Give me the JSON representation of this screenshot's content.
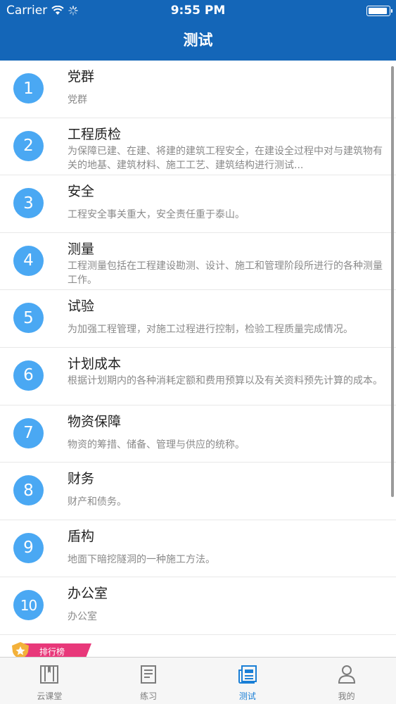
{
  "status_bar": {
    "carrier": "Carrier",
    "time": "9:55 PM",
    "battery_level": 0.95
  },
  "nav": {
    "title": "测试"
  },
  "items": [
    {
      "number": "1",
      "title": "党群",
      "description": "党群"
    },
    {
      "number": "2",
      "title": "工程质检",
      "description": "为保障已建、在建、将建的建筑工程安全，在建设全过程中对与建筑物有关的地基、建筑材料、施工工艺、建筑结构进行测试..."
    },
    {
      "number": "3",
      "title": "安全",
      "description": "工程安全事关重大，安全责任重于泰山。"
    },
    {
      "number": "4",
      "title": "测量",
      "description": "工程测量包括在工程建设勘测、设计、施工和管理阶段所进行的各种测量工作。"
    },
    {
      "number": "5",
      "title": "试验",
      "description": "为加强工程管理，对施工过程进行控制，检验工程质量完成情况。"
    },
    {
      "number": "6",
      "title": "计划成本",
      "description": "根据计划期内的各种消耗定额和费用预算以及有关资料预先计算的成本。"
    },
    {
      "number": "7",
      "title": "物资保障",
      "description": "物资的筹措、储备、管理与供应的统称。"
    },
    {
      "number": "8",
      "title": "财务",
      "description": "财产和债务。"
    },
    {
      "number": "9",
      "title": "盾构",
      "description": "地面下暗挖隧洞的一种施工方法。"
    },
    {
      "number": "10",
      "title": "办公室",
      "description": "办公室"
    }
  ],
  "leaderboard_badge": {
    "label": "排行榜",
    "icon": "star-shield-icon",
    "color": "#e8387a"
  },
  "tabs": [
    {
      "label": "云课堂",
      "icon": "book-icon",
      "active": false
    },
    {
      "label": "练习",
      "icon": "notepad-icon",
      "active": false
    },
    {
      "label": "测试",
      "icon": "newspaper-icon",
      "active": true
    },
    {
      "label": "我的",
      "icon": "person-icon",
      "active": false
    }
  ],
  "colors": {
    "nav_background": "#1466b8",
    "number_circle": "#4aa8f3",
    "active_tab": "#1a7fd6",
    "inactive_tab": "#7c7c7c"
  }
}
